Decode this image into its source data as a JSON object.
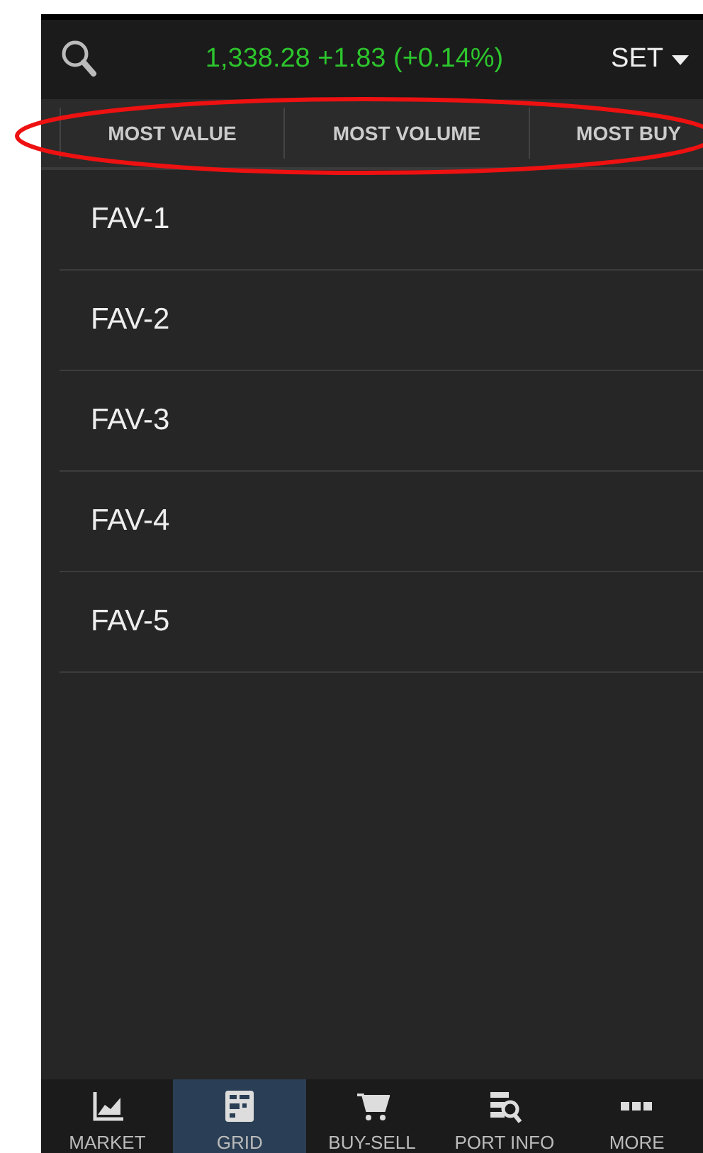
{
  "header": {
    "index_quote": "1,338.28 +1.83 (+0.14%)",
    "market": "SET"
  },
  "tabs": [
    {
      "label": "MOST VALUE"
    },
    {
      "label": "MOST VOLUME"
    },
    {
      "label": "MOST BUY"
    }
  ],
  "favorites": [
    "FAV-1",
    "FAV-2",
    "FAV-3",
    "FAV-4",
    "FAV-5"
  ],
  "bottom_nav": [
    {
      "label": "MARKET",
      "selected": false
    },
    {
      "label": "GRID",
      "selected": true
    },
    {
      "label": "BUY-SELL",
      "selected": false
    },
    {
      "label": "PORT INFO",
      "selected": false
    },
    {
      "label": "MORE",
      "selected": false
    }
  ]
}
